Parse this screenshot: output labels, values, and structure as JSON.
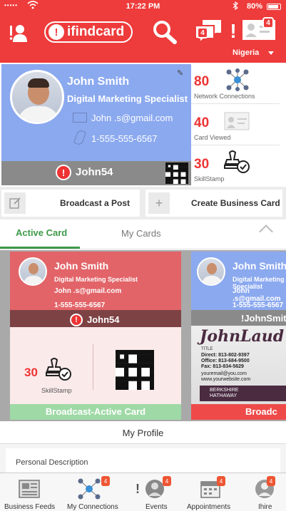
{
  "status_bar": {
    "signal": "•••••",
    "time": "17:22 PM",
    "battery": "80%"
  },
  "header": {
    "logo_text": "ifindcard",
    "logo_mark": "!",
    "alert_mark": "!",
    "chat_badge": "4",
    "card_badge": "4",
    "country": "Nigeria",
    "accent_color": "#ee3b3b",
    "icons": [
      "profile-icon",
      "search-icon",
      "chat-icon",
      "alert-icon",
      "business-card-icon"
    ]
  },
  "active_card": {
    "name": "John Smith",
    "title": "Digital Marketing Specialist",
    "email": "John .s@gmail.com",
    "phone": "1-555-555-6567",
    "handle": "John54",
    "alert_mark": "!"
  },
  "stats": [
    {
      "value": "80",
      "label": "Network  Connections",
      "icon": "network-icon"
    },
    {
      "value": "40",
      "label": "Card Viewed",
      "icon": "card-icon"
    },
    {
      "value": "30",
      "label": "SkillStamp",
      "icon": "stamp-icon"
    }
  ],
  "actions": {
    "broadcast_label": "Broadcast a Post",
    "create_label": "Create Business Card",
    "create_icon_glyph": "+"
  },
  "tabs": {
    "active": "Active  Card",
    "inactive": "My Cards"
  },
  "cards": [
    {
      "name": "John Smith",
      "title": "Digital Marketing Specialist",
      "email": "John .s@gmail.com",
      "phone": "1-555-555-6567",
      "handle": "John54",
      "skill_value": "30",
      "skill_label": "SkillStamp",
      "footer": "Broadcast-Active Card",
      "alert_mark": "!"
    },
    {
      "name": "John Smith",
      "title": "Digital Marketing Specialist",
      "email": "John .s@gmail.com",
      "phone": "1-555-555-6567",
      "handle": "!JohnSmith",
      "biz_signature": "JohnLaud",
      "biz_title": "TITLE",
      "biz_direct": "Direct: 813-802-9397",
      "biz_office": "Office: 813-684-9500",
      "biz_fax": "Fax:     813-834-5629",
      "biz_email": "youremail@you.com",
      "biz_web": "www.yourwebsite.com",
      "biz_company_1": "BERKSHIRE",
      "biz_company_2": "HATHAWAY",
      "footer": "Broadc"
    }
  ],
  "profile": {
    "title": "My Profile",
    "field_label": "Personal  Description"
  },
  "bottom_nav": [
    {
      "label": "Business Feeds",
      "icon": "news-icon"
    },
    {
      "label": "My Connections",
      "icon": "network-icon",
      "badge": "4"
    },
    {
      "label": "Events",
      "icon": "events-icon",
      "badge": "4",
      "mark": "!"
    },
    {
      "label": "Appointments",
      "icon": "calendar-icon",
      "badge": "4"
    },
    {
      "label": "Ihire",
      "icon": "hire-icon",
      "badge": "4"
    }
  ]
}
